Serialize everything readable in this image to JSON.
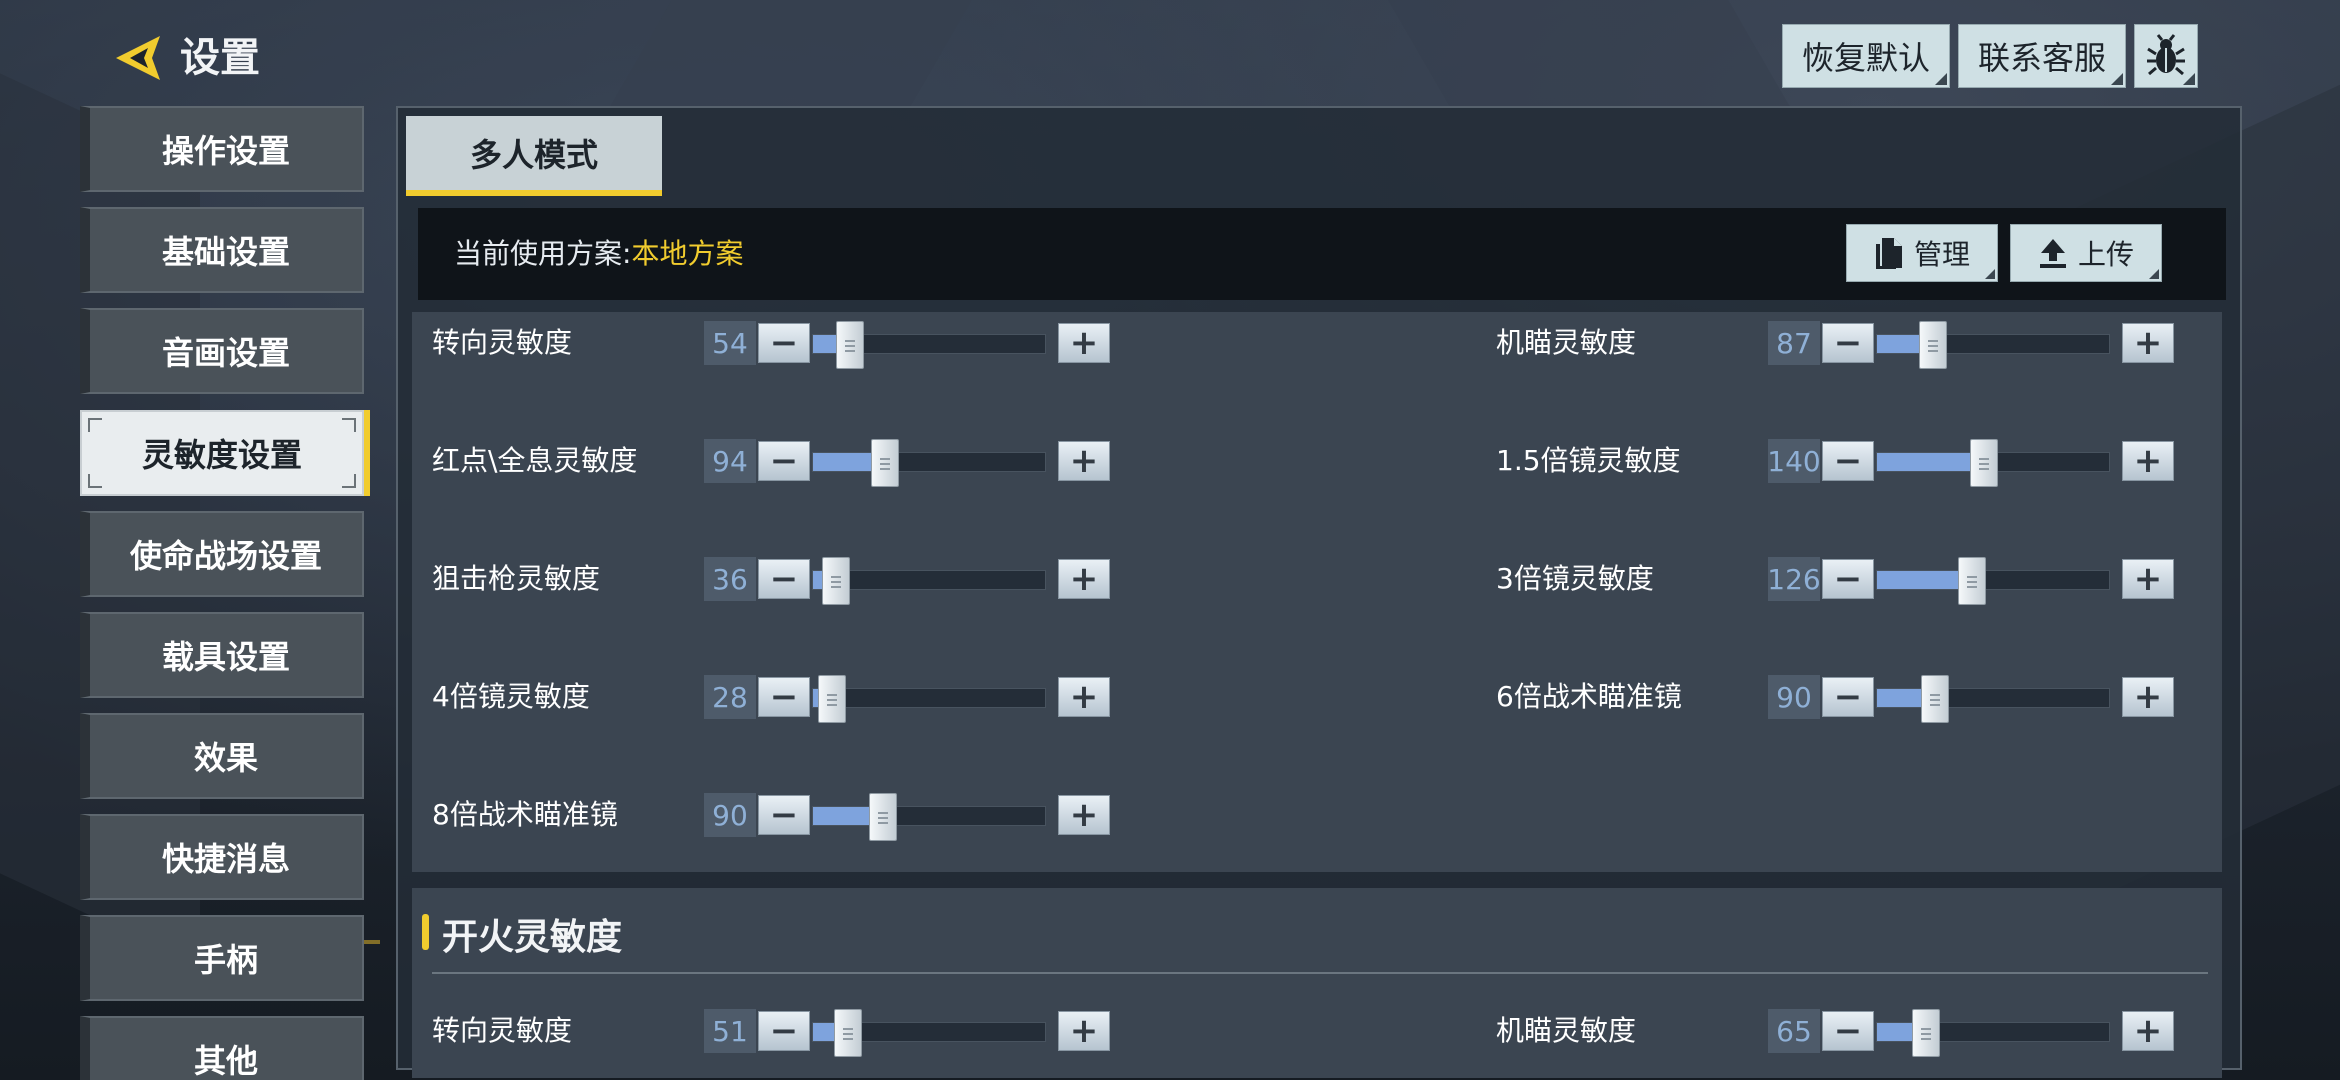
{
  "header": {
    "title": "设置",
    "restore_label": "恢复默认",
    "contact_label": "联系客服",
    "bug_icon": "bug-icon",
    "back_icon": "back-arrow-icon"
  },
  "colors": {
    "accent": "#f1cc2e",
    "slider_fill": "#7ea3dd",
    "panel_bg": "#3b4551"
  },
  "sidebar": {
    "items": [
      {
        "label": "操作设置"
      },
      {
        "label": "基础设置"
      },
      {
        "label": "音画设置"
      },
      {
        "label": "灵敏度设置",
        "active": true
      },
      {
        "label": "使命战场设置"
      },
      {
        "label": "载具设置"
      },
      {
        "label": "效果"
      },
      {
        "label": "快捷消息"
      },
      {
        "label": "手柄"
      },
      {
        "label": "其他"
      }
    ]
  },
  "main": {
    "tab_label": "多人模式",
    "scheme": {
      "label": "当前使用方案:",
      "value": "本地方案",
      "manage_label": "管理",
      "upload_label": "上传"
    },
    "sensitivity": [
      {
        "label": "转向灵敏度",
        "value": "54",
        "fill": 0.16
      },
      {
        "label": "机瞄灵敏度",
        "value": "87",
        "fill": 0.24
      },
      {
        "label": "红点\\全息灵敏度",
        "value": "94",
        "fill": 0.31
      },
      {
        "label": "1.5倍镜灵敏度",
        "value": "140",
        "fill": 0.46
      },
      {
        "label": "狙击枪灵敏度",
        "value": "36",
        "fill": 0.1
      },
      {
        "label": "3倍镜灵敏度",
        "value": "126",
        "fill": 0.41
      },
      {
        "label": "4倍镜灵敏度",
        "value": "28",
        "fill": 0.08
      },
      {
        "label": "6倍战术瞄准镜",
        "value": "90",
        "fill": 0.25
      },
      {
        "label": "8倍战术瞄准镜",
        "value": "90",
        "fill": 0.3
      }
    ],
    "fire_section": {
      "title": "开火灵敏度",
      "rows": [
        {
          "label": "转向灵敏度",
          "value": "51",
          "fill": 0.15
        },
        {
          "label": "机瞄灵敏度",
          "value": "65",
          "fill": 0.21
        }
      ]
    },
    "minus_symbol": "−",
    "plus_symbol": "+"
  }
}
